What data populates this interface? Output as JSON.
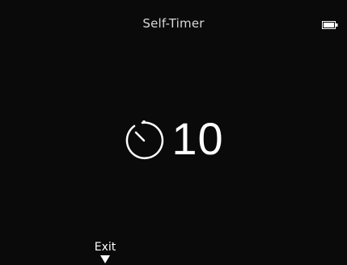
{
  "header": {
    "title": "Self-Timer",
    "battery_icon": "battery-icon"
  },
  "timer": {
    "icon": "stopwatch-icon",
    "value": "10"
  },
  "footer": {
    "exit_label": "Exit",
    "exit_icon": "down-triangle-icon"
  },
  "colors": {
    "background": "#0a0a0a",
    "foreground": "#ffffff"
  }
}
